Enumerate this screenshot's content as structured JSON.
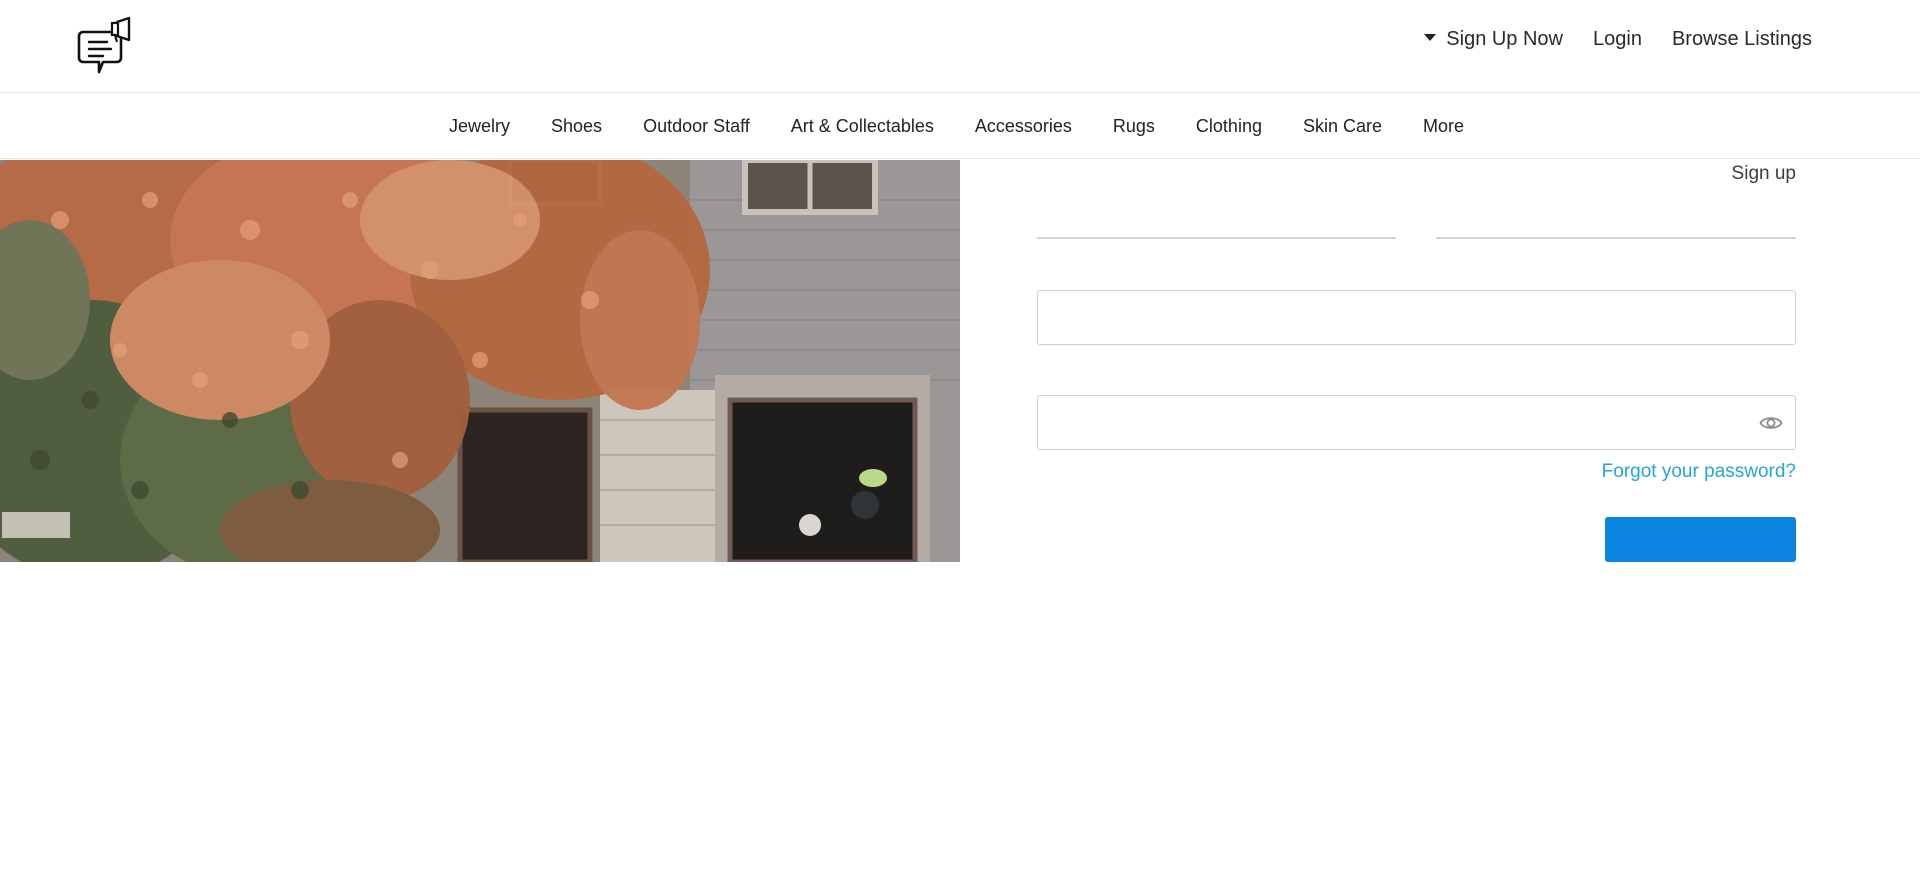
{
  "header": {
    "logo_icon": "chat-megaphone-logo-icon",
    "nav": {
      "signup_now": "Sign Up Now",
      "login": "Login",
      "browse": "Browse Listings"
    }
  },
  "categories": [
    {
      "label": "Jewelry"
    },
    {
      "label": "Shoes"
    },
    {
      "label": "Outdoor Staff"
    },
    {
      "label": "Art & Collectables"
    },
    {
      "label": "Accessories"
    },
    {
      "label": "Rugs"
    },
    {
      "label": "Clothing"
    },
    {
      "label": "Skin Care"
    },
    {
      "label": "More"
    }
  ],
  "hero": {
    "icon": "ivy-building-photo"
  },
  "form": {
    "signup_tab": "Sign up",
    "email_value": "",
    "password_value": "",
    "password_toggle_icon": "eye-icon",
    "forgot_password": "Forgot your password?",
    "submit_label": ""
  },
  "colors": {
    "accent_button": "#0a84e0",
    "link": "#22a6d9",
    "tab_underline": "#c9d7e3"
  }
}
